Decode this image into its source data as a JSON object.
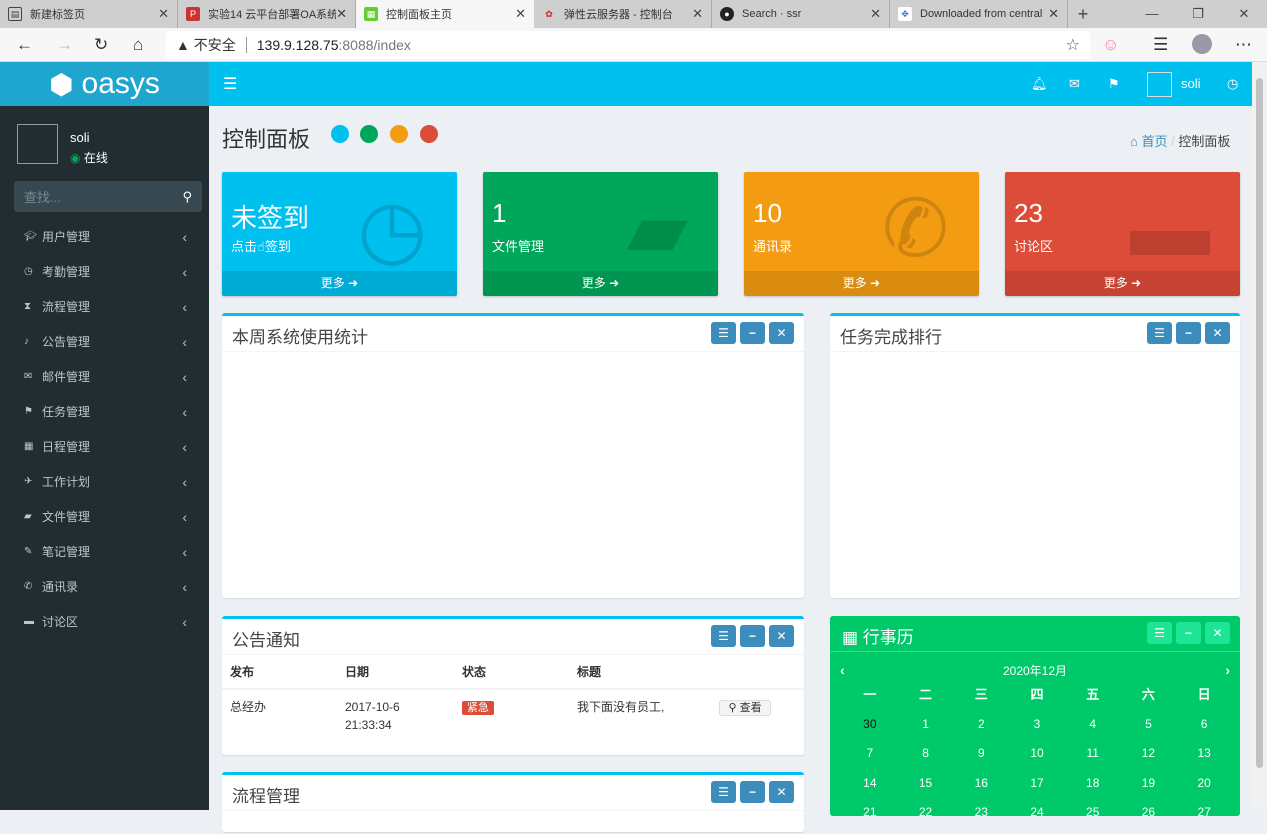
{
  "browser": {
    "tabs": [
      {
        "title": "新建标签页",
        "icon": "page-icon"
      },
      {
        "title": "实验14 云平台部署OA系统",
        "icon": "pdf-icon"
      },
      {
        "title": "控制面板主页",
        "icon": "oasys-icon",
        "active": true
      },
      {
        "title": "弹性云服务器 - 控制台",
        "icon": "huawei-icon"
      },
      {
        "title": "Search · ssr",
        "icon": "github-icon"
      },
      {
        "title": "Downloaded from central",
        "icon": "baidu-icon"
      }
    ],
    "security": "不安全",
    "url_host": "139.9.128.75",
    "url_path": ":8088/index"
  },
  "app": {
    "logo": "oasys",
    "user": "soli"
  },
  "sidebar": {
    "user": "soli",
    "status": "在线",
    "search_placeholder": "查找...",
    "items": [
      {
        "label": "用户管理",
        "icon": "graduation-cap-icon"
      },
      {
        "label": "考勤管理",
        "icon": "clock-icon"
      },
      {
        "label": "流程管理",
        "icon": "hourglass-icon"
      },
      {
        "label": "公告管理",
        "icon": "bell-icon"
      },
      {
        "label": "邮件管理",
        "icon": "envelope-icon"
      },
      {
        "label": "任务管理",
        "icon": "flag-icon"
      },
      {
        "label": "日程管理",
        "icon": "calendar-icon"
      },
      {
        "label": "工作计划",
        "icon": "plane-icon"
      },
      {
        "label": "文件管理",
        "icon": "folder-icon"
      },
      {
        "label": "笔记管理",
        "icon": "edit-icon"
      },
      {
        "label": "通讯录",
        "icon": "phone-icon"
      },
      {
        "label": "讨论区",
        "icon": "comment-icon"
      }
    ]
  },
  "page": {
    "title": "控制面板",
    "breadcrumb": [
      "首页",
      "控制面板"
    ]
  },
  "colors": {
    "aqua": "#00c0ef",
    "green": "#00a65a",
    "orange": "#f39c12",
    "red": "#dd4b39"
  },
  "cards": [
    {
      "num": "未签到",
      "sub": "点击☝签到",
      "more": "更多"
    },
    {
      "num": "1",
      "sub": "文件管理",
      "more": "更多"
    },
    {
      "num": "10",
      "sub": "通讯录",
      "more": "更多"
    },
    {
      "num": "23",
      "sub": "讨论区",
      "more": "更多"
    }
  ],
  "boxes": {
    "weekly": "本周系统使用统计",
    "ranking": "任务完成排行",
    "notice": "公告通知",
    "process": "流程管理"
  },
  "notice": {
    "headers": [
      "发布",
      "日期",
      "状态",
      "标题"
    ],
    "rows": [
      {
        "from": "总经办",
        "date": "2017-10-6",
        "time": "21:33:34",
        "status": "紧急",
        "title": "我下面没有员工,",
        "action": "查看"
      }
    ]
  },
  "calendar": {
    "title": "行事历",
    "month": "2020年12月",
    "weekdays": [
      "一",
      "二",
      "三",
      "四",
      "五",
      "六",
      "日"
    ],
    "days": [
      "30",
      "1",
      "2",
      "3",
      "4",
      "5",
      "6",
      "7",
      "8",
      "9",
      "10",
      "11",
      "12",
      "13",
      "14",
      "15",
      "16",
      "17",
      "18",
      "19",
      "20",
      "21",
      "22",
      "23",
      "24",
      "25",
      "26",
      "27"
    ]
  }
}
